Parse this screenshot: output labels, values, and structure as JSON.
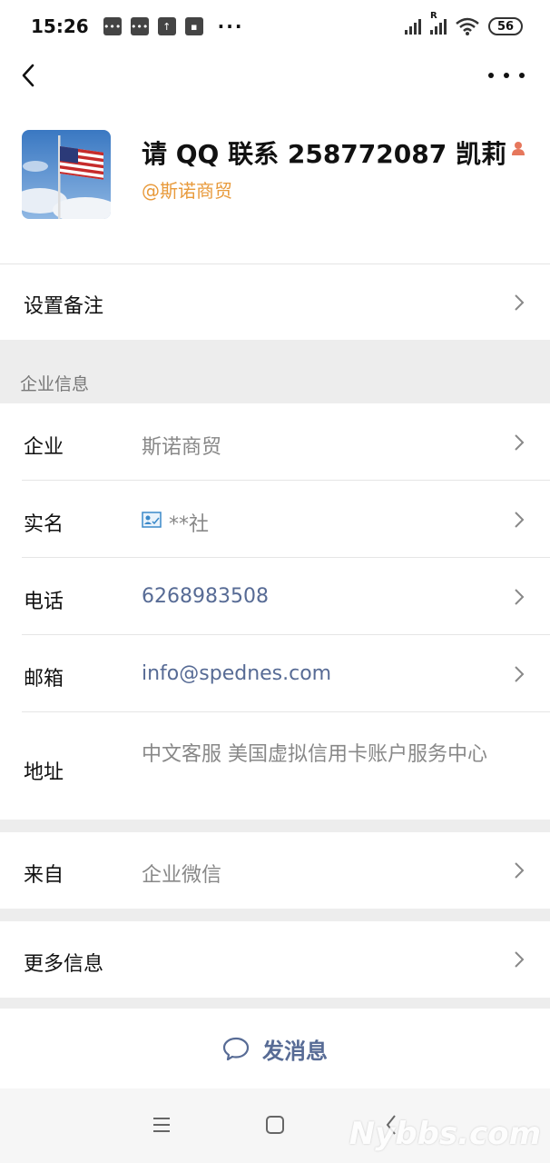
{
  "status_bar": {
    "time": "15:26",
    "battery": "56",
    "dots": "···",
    "r_label": "R"
  },
  "profile": {
    "name": "请 QQ 联系 258772087 凯莉",
    "org": "@斯诺商贸"
  },
  "remark": {
    "label": "设置备注"
  },
  "enterprise_section": {
    "title": "企业信息",
    "rows": [
      {
        "label": "企业",
        "value": "斯诺商贸"
      },
      {
        "label": "实名",
        "value": "**社"
      },
      {
        "label": "电话",
        "value": "6268983508"
      },
      {
        "label": "邮箱",
        "value": "info@spednes.com"
      },
      {
        "label": "地址",
        "value": "中文客服 美国虚拟信用卡账户服务中心"
      }
    ]
  },
  "source": {
    "label": "来自",
    "value": "企业微信"
  },
  "more_info": {
    "label": "更多信息"
  },
  "send": {
    "label": "发消息"
  },
  "watermark": "Nybbs.com",
  "icons": {
    "back": "back-arrow-icon",
    "more": "more-dots-icon",
    "chevron": "chevron-right-icon",
    "verify": "id-card-icon",
    "chat": "chat-bubble-icon"
  },
  "colors": {
    "link": "#576b95",
    "org": "#e89a3b",
    "muted": "#888888",
    "background": "#ededed"
  }
}
